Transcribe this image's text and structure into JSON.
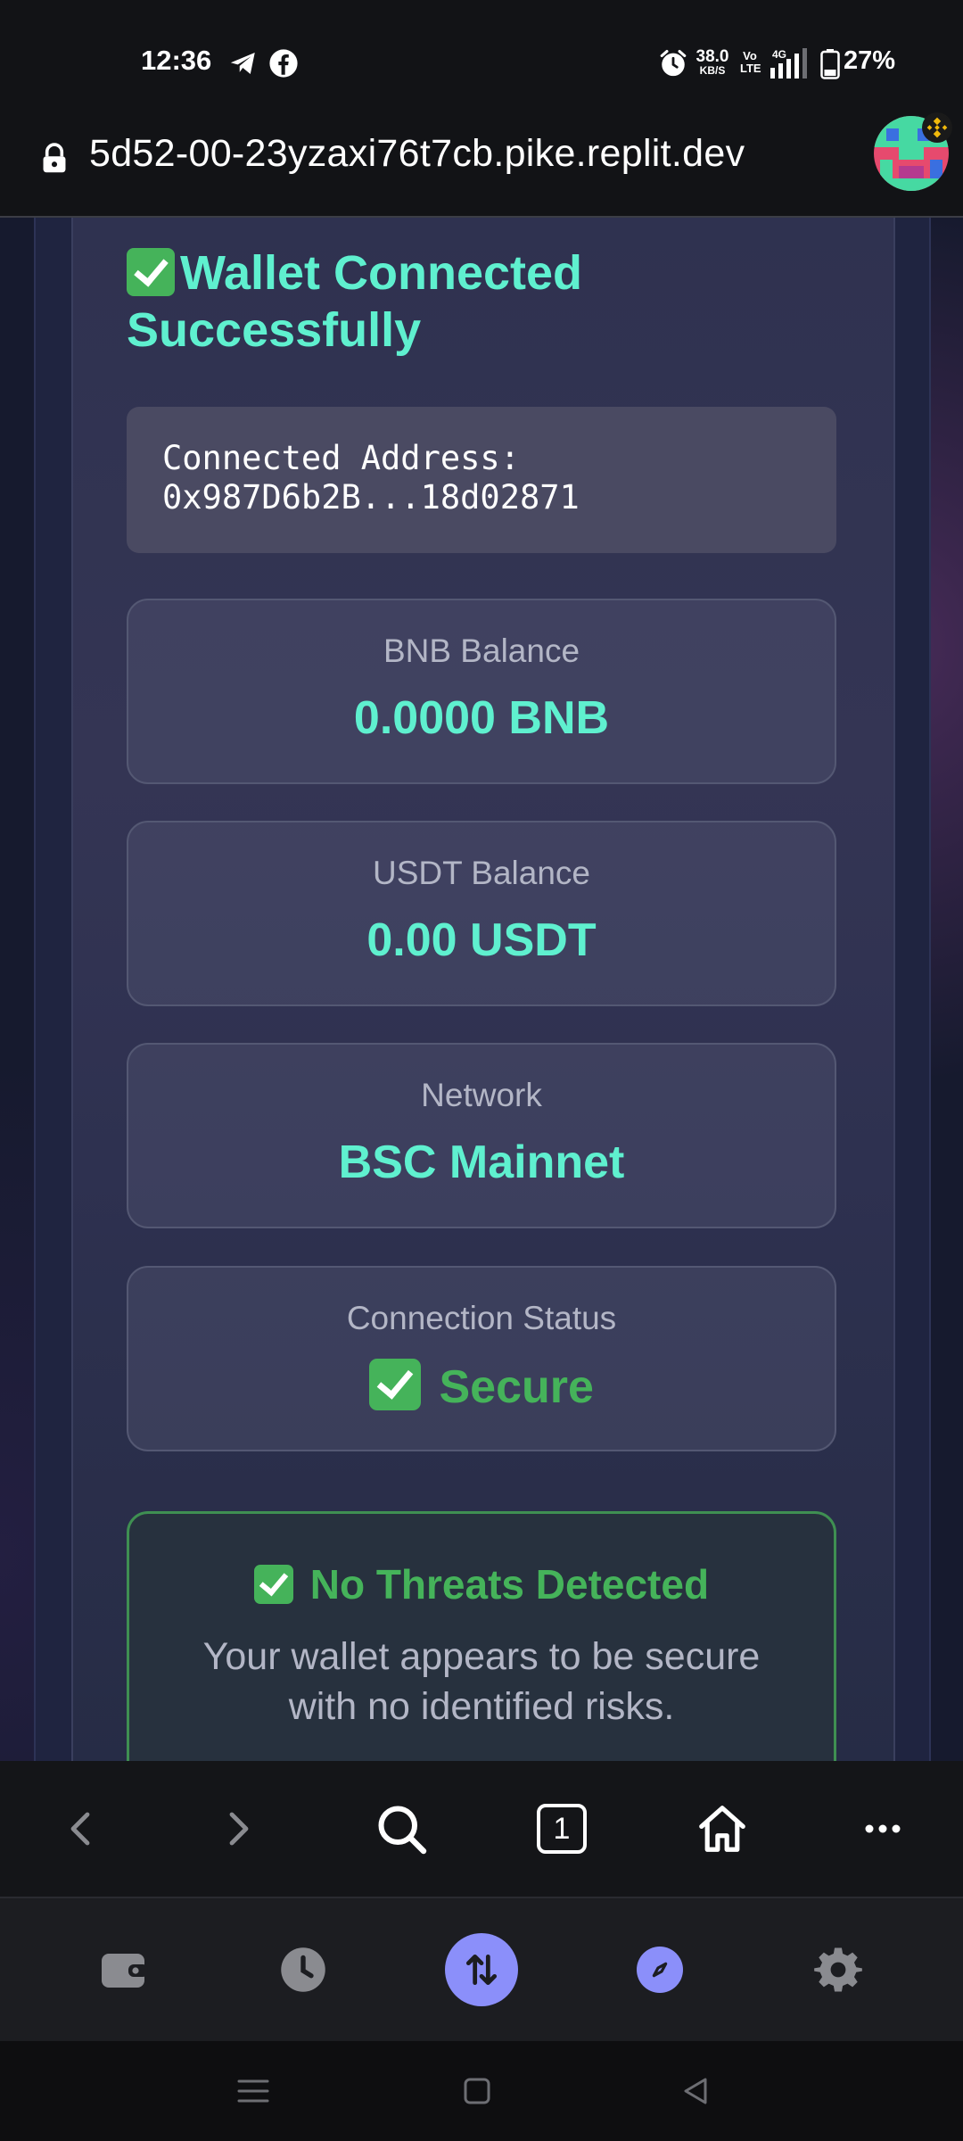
{
  "status_bar": {
    "time": "12:36",
    "net_speed_value": "38.0",
    "net_speed_unit": "KB/S",
    "volte_line1": "Vo",
    "volte_line2": "LTE",
    "network_type": "4G",
    "battery_percent": "27%",
    "icons": [
      "telegram-icon",
      "facebook-icon",
      "alarm-icon",
      "signal-icon",
      "battery-icon"
    ]
  },
  "url_bar": {
    "url": "5d52-00-23yzaxi76t7cb.pike.replit.dev"
  },
  "page": {
    "title": "Wallet Connected Successfully",
    "address": {
      "label": "Connected Address:",
      "value": "0x987D6b2B...18d02871"
    },
    "cards": [
      {
        "label": "BNB Balance",
        "value": "0.0000 BNB"
      },
      {
        "label": "USDT Balance",
        "value": "0.00 USDT"
      },
      {
        "label": "Network",
        "value": "BSC Mainnet"
      },
      {
        "label": "Connection Status",
        "value": "Secure"
      }
    ],
    "threat": {
      "title": "No Threats Detected",
      "description": "Your wallet appears to be secure with no identified risks."
    }
  },
  "toolbar": {
    "tab_count": "1",
    "icons": [
      "back-icon",
      "forward-icon",
      "search-icon",
      "tabs-icon",
      "home-icon",
      "more-icon"
    ]
  },
  "bottom_nav": {
    "icons": [
      "wallet-icon",
      "history-icon",
      "swap-icon",
      "discover-icon",
      "settings-icon"
    ]
  },
  "colors": {
    "accent_teal": "#5ff0cf",
    "success_green": "#45b35a",
    "nav_accent": "#8b8ffa"
  }
}
